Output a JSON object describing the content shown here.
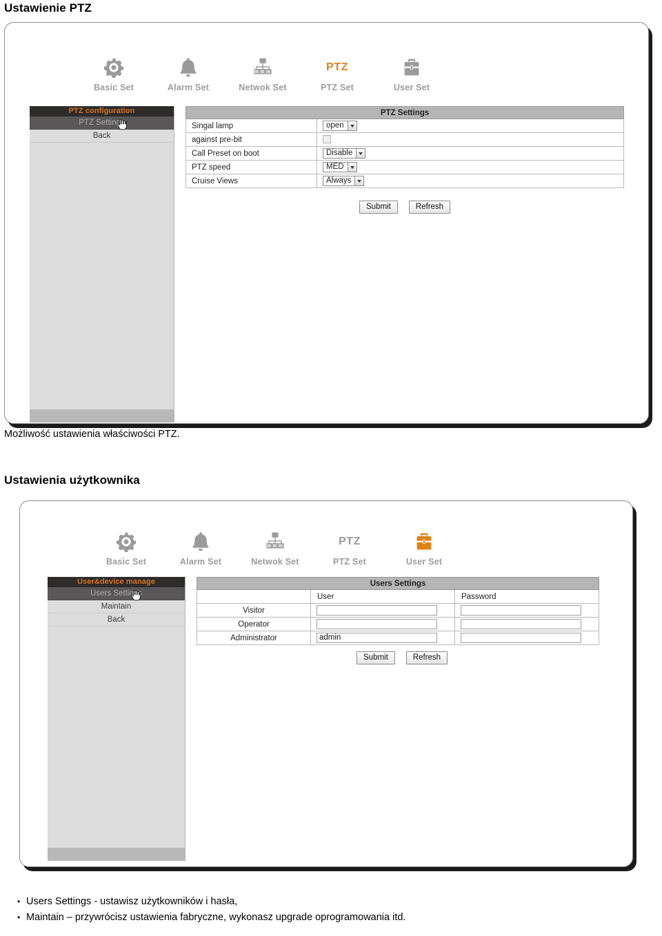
{
  "document": {
    "heading1": "Ustawienie PTZ",
    "caption1": "Możliwość ustawienia właściwości PTZ.",
    "heading2": "Ustawienia użytkownika",
    "bullets": [
      {
        "marker": "•",
        "text": "Users Settings -  ustawisz użytkowników i hasła,"
      },
      {
        "marker": "•",
        "text": "Maintain – przywrócisz ustawienia fabryczne, wykonasz upgrade oprogramowania itd."
      }
    ]
  },
  "colors": {
    "accent_orange": "#d8761f",
    "nav_gray": "#9b9b9b",
    "sidebar_head_bg": "#2e2b2b",
    "sidebar_bg": "#dcdcdc",
    "table_head_bg": "#b5b5b5"
  },
  "shot_ptz": {
    "nav": [
      {
        "label": "Basic Set",
        "icon": "gear-icon",
        "active": false
      },
      {
        "label": "Alarm Set",
        "icon": "bell-icon",
        "active": false
      },
      {
        "label": "Netwok Set",
        "icon": "network-icon",
        "active": false
      },
      {
        "label": "PTZ Set",
        "icon": "ptz-text-icon",
        "active": true
      },
      {
        "label": "User Set",
        "icon": "briefcase-icon",
        "active": false
      }
    ],
    "sidebar": {
      "header": "PTZ configuration",
      "items": [
        {
          "label": "PTZ Settings",
          "selected": true
        },
        {
          "label": "Back",
          "selected": false
        }
      ]
    },
    "table": {
      "title": "PTZ Settings",
      "rows": [
        {
          "label": "Singal lamp",
          "control": "select",
          "value": "open"
        },
        {
          "label": "against pre-bit",
          "control": "checkbox",
          "value": ""
        },
        {
          "label": "Call Preset on boot",
          "control": "select",
          "value": "Disable"
        },
        {
          "label": "PTZ speed",
          "control": "select",
          "value": "MED"
        },
        {
          "label": "Cruise Views",
          "control": "select",
          "value": "Always"
        }
      ]
    },
    "buttons": {
      "submit": "Submit",
      "refresh": "Refresh"
    }
  },
  "shot_user": {
    "nav": [
      {
        "label": "Basic Set",
        "icon": "gear-icon",
        "active": false
      },
      {
        "label": "Alarm Set",
        "icon": "bell-icon",
        "active": false
      },
      {
        "label": "Netwok Set",
        "icon": "network-icon",
        "active": false
      },
      {
        "label": "PTZ Set",
        "icon": "ptz-text-icon",
        "active": false
      },
      {
        "label": "User Set",
        "icon": "briefcase-icon",
        "active": true
      }
    ],
    "sidebar": {
      "header": "User&device manage",
      "items": [
        {
          "label": "Users Settings",
          "selected": true
        },
        {
          "label": "Maintain",
          "selected": false
        },
        {
          "label": "Back",
          "selected": false
        }
      ]
    },
    "table": {
      "title": "Users Settings",
      "columns": [
        "",
        "User",
        "Password"
      ],
      "rows": [
        {
          "role": "Visitor",
          "user": "",
          "password": ""
        },
        {
          "role": "Operator",
          "user": "",
          "password": ""
        },
        {
          "role": "Administrator",
          "user": "admin",
          "password": ""
        }
      ]
    },
    "buttons": {
      "submit": "Submit",
      "refresh": "Refresh"
    }
  }
}
